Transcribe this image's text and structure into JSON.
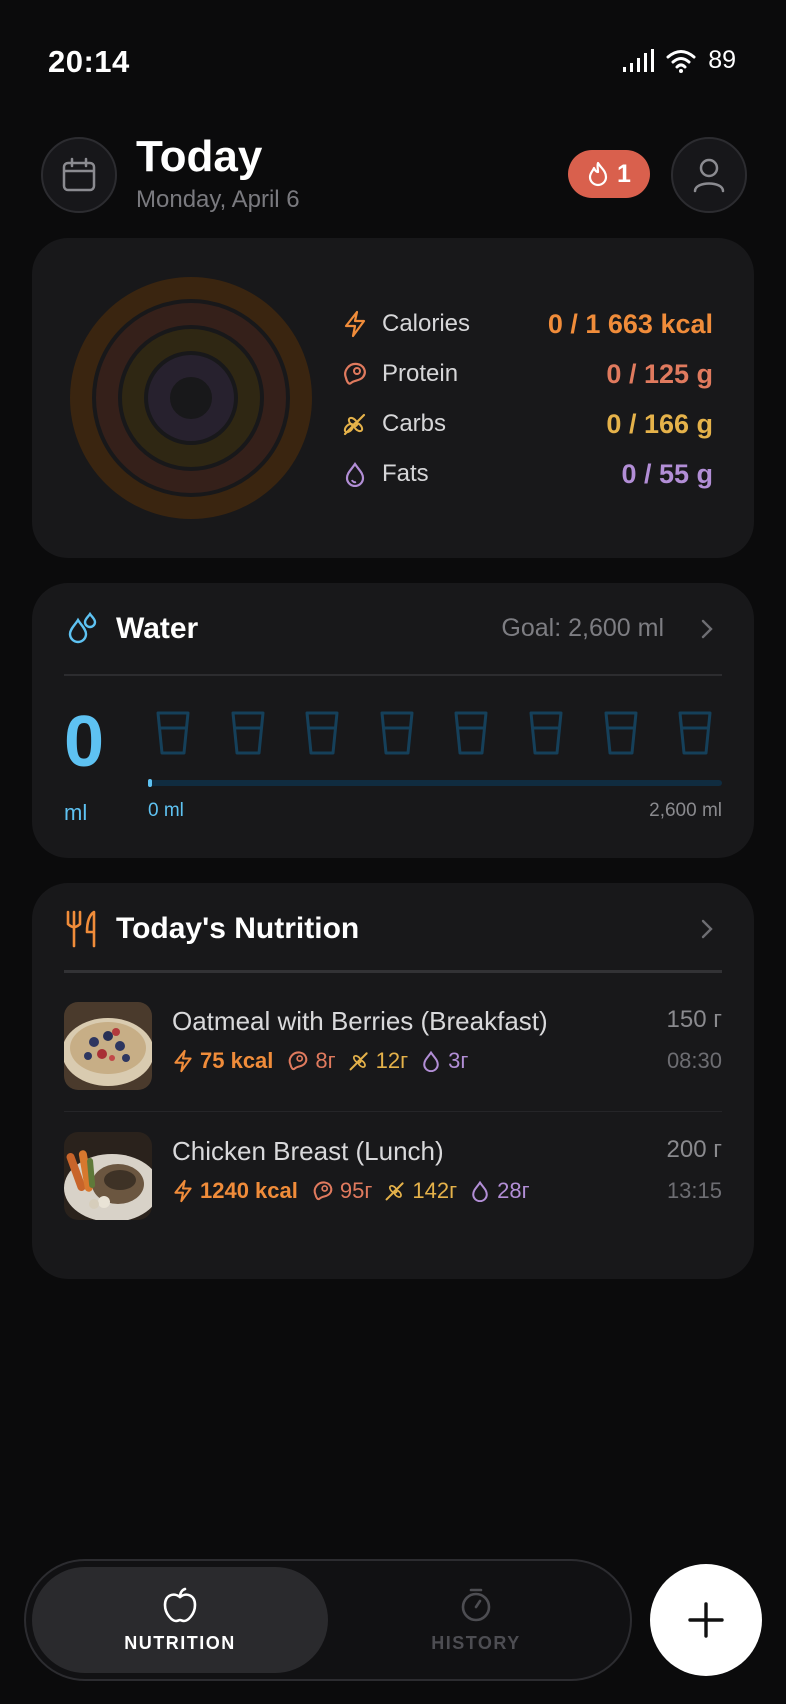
{
  "status": {
    "time": "20:14",
    "battery": "89"
  },
  "header": {
    "title": "Today",
    "date": "Monday, April 6",
    "streak": "1"
  },
  "summary": {
    "macros": [
      {
        "label": "Calories",
        "value": "0 / 1 663 kcal",
        "color": "#f08c3a",
        "icon": "bolt-icon"
      },
      {
        "label": "Protein",
        "value": "0 / 125 g",
        "color": "#e07a5e",
        "icon": "meat-icon"
      },
      {
        "label": "Carbs",
        "value": "0 / 166 g",
        "color": "#e5b24a",
        "icon": "grain-icon"
      },
      {
        "label": "Fats",
        "value": "0 / 55 g",
        "color": "#b28ed6",
        "icon": "drop-icon"
      }
    ]
  },
  "water": {
    "title": "Water",
    "goal": "Goal: 2,600 ml",
    "amount": "0",
    "unit": "ml",
    "min_label": "0 ml",
    "max_label": "2,600 ml",
    "glasses": 8,
    "progress": 0,
    "accent": "#5ec2f2"
  },
  "nutrition": {
    "title": "Today's Nutrition",
    "meals": [
      {
        "name": "Oatmeal with Berries (Breakfast)",
        "weight": "150 г",
        "time": "08:30",
        "kcal": "75 kcal",
        "protein": "8г",
        "carbs": "12г",
        "fats": "3г"
      },
      {
        "name": "Chicken Breast (Lunch)",
        "weight": "200 г",
        "time": "13:15",
        "kcal": "1240 kcal",
        "protein": "95г",
        "carbs": "142г",
        "fats": "28г"
      }
    ]
  },
  "nav": {
    "nutrition": "NUTRITION",
    "history": "HISTORY"
  }
}
